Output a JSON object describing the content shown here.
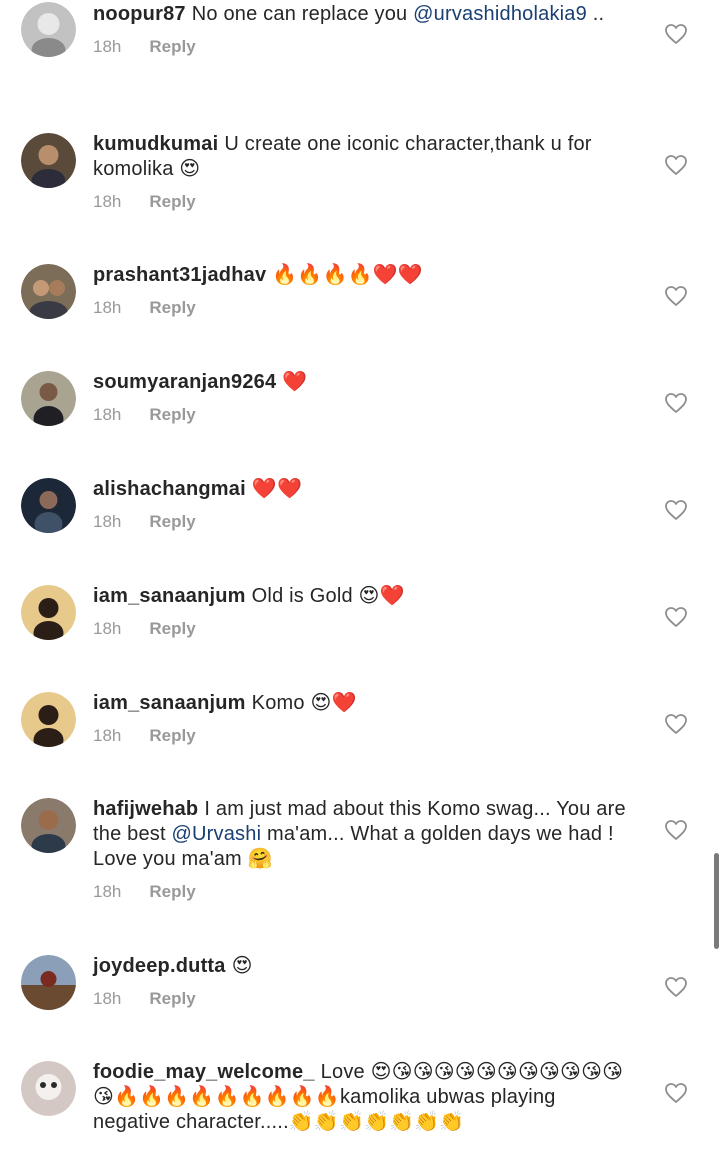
{
  "comments": [
    {
      "username": "noopur87",
      "pre": "No one can replace you ",
      "mention": "@urvashidholakia9",
      "post": " ..",
      "time": "18h",
      "reply": "Reply",
      "avatar_color": "#b9b9b9"
    },
    {
      "username": "kumudkumai",
      "pre": "U create one iconic character,thank u for komolika 😍",
      "mention": "",
      "post": "",
      "time": "18h",
      "reply": "Reply",
      "avatar_color": "#4c3a2a"
    },
    {
      "username": "prashant31jadhav",
      "pre": "🔥🔥🔥🔥❤️❤️",
      "mention": "",
      "post": "",
      "time": "18h",
      "reply": "Reply",
      "avatar_color": "#6e6250"
    },
    {
      "username": "soumyaranjan9264",
      "pre": "❤️",
      "mention": "",
      "post": "",
      "time": "18h",
      "reply": "Reply",
      "avatar_color": "#8f8878"
    },
    {
      "username": "alishachangmai",
      "pre": "❤️❤️",
      "mention": "",
      "post": "",
      "time": "18h",
      "reply": "Reply",
      "avatar_color": "#1d2a3c"
    },
    {
      "username": "iam_sanaanjum",
      "pre": "Old is Gold 😍❤️",
      "mention": "",
      "post": "",
      "time": "18h",
      "reply": "Reply",
      "avatar_color": "#d9b36a"
    },
    {
      "username": "iam_sanaanjum",
      "pre": "Komo 😍❤️",
      "mention": "",
      "post": "",
      "time": "18h",
      "reply": "Reply",
      "avatar_color": "#d9b36a"
    },
    {
      "username": "hafijwehab",
      "pre": "I am just mad about this Komo swag... You are the best ",
      "mention": "@Urvashi",
      "post": " ma'am... What a golden days we had !  Love you ma'am 🤗",
      "time": "18h",
      "reply": "Reply",
      "avatar_color": "#7a6a5a"
    },
    {
      "username": "joydeep.dutta",
      "pre": "😍",
      "mention": "",
      "post": "",
      "time": "18h",
      "reply": "Reply",
      "avatar_color": "#7a3a2a"
    },
    {
      "username": "foodie_may_welcome_",
      "pre": "Love 😍😘😘😘😘😘😘😘😘😘😘😘😘🔥🔥🔥🔥🔥🔥🔥🔥🔥kamolika ubwas playing negative character.....👏👏👏👏👏👏👏",
      "mention": "",
      "post": "",
      "time": "",
      "reply": "",
      "avatar_color": "#c7b7b0"
    }
  ]
}
